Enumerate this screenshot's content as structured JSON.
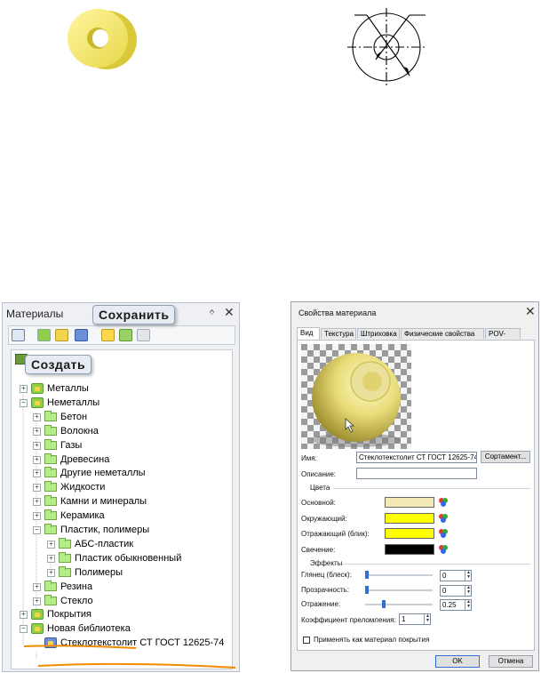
{
  "materials_panel": {
    "title": "Материалы",
    "pin_glyph": "ᛜ",
    "close_glyph": "✕",
    "callout_save": "Сохранить",
    "callout_create": "Создать",
    "tree": [
      {
        "label": "Металлы",
        "type": "library",
        "level": 0,
        "expander": "+"
      },
      {
        "label": "Неметаллы",
        "type": "library",
        "level": 0,
        "expander": "−"
      },
      {
        "label": "Бетон",
        "type": "folder",
        "level": 1,
        "expander": "+"
      },
      {
        "label": "Волокна",
        "type": "folder",
        "level": 1,
        "expander": "+"
      },
      {
        "label": "Газы",
        "type": "folder",
        "level": 1,
        "expander": "+"
      },
      {
        "label": "Древесина",
        "type": "folder",
        "level": 1,
        "expander": "+"
      },
      {
        "label": "Другие неметаллы",
        "type": "folder",
        "level": 1,
        "expander": "+"
      },
      {
        "label": "Жидкости",
        "type": "folder",
        "level": 1,
        "expander": "+"
      },
      {
        "label": "Камни и минералы",
        "type": "folder",
        "level": 1,
        "expander": "+"
      },
      {
        "label": "Керамика",
        "type": "folder",
        "level": 1,
        "expander": "+"
      },
      {
        "label": "Пластик, полимеры",
        "type": "folder",
        "level": 1,
        "expander": "−"
      },
      {
        "label": "АБС-пластик",
        "type": "folder",
        "level": 2,
        "expander": "+"
      },
      {
        "label": "Пластик обыкновенный",
        "type": "folder",
        "level": 2,
        "expander": "+"
      },
      {
        "label": "Полимеры",
        "type": "folder",
        "level": 2,
        "expander": "+"
      },
      {
        "label": "Резина",
        "type": "folder",
        "level": 1,
        "expander": "+"
      },
      {
        "label": "Стекло",
        "type": "folder",
        "level": 1,
        "expander": "+"
      },
      {
        "label": "Покрытия",
        "type": "library",
        "level": 0,
        "expander": "+"
      },
      {
        "label": "Новая библиотека",
        "type": "library",
        "level": 0,
        "expander": "−"
      },
      {
        "label": "Стеклотекстолит СТ ГОСТ 12625-74",
        "type": "material",
        "level": 1,
        "expander": ""
      }
    ],
    "highlight_color": "#f08a00"
  },
  "dialog": {
    "title": "Свойства материала",
    "close_glyph": "✕",
    "tabs": [
      "Вид",
      "Текстура",
      "Штриховка",
      "Физические свойства",
      "POV-Ray"
    ],
    "active_tab": "Вид",
    "name_label": "Имя:",
    "name_value": "Стеклотекстолит СТ ГОСТ 12625-74",
    "sortament_button": "Сортамент...",
    "description_label": "Описание:",
    "description_value": "",
    "colors_group": "Цвета",
    "colors": [
      {
        "label": "Основной:",
        "color": "#f3eab8"
      },
      {
        "label": "Окружающий:",
        "color": "#ffff00"
      },
      {
        "label": "Отражающий (блик):",
        "color": "#ffff00"
      },
      {
        "label": "Свечение:",
        "color": "#000000"
      }
    ],
    "effects_group": "Эффекты",
    "effects": [
      {
        "label": "Глянец (блеск):",
        "value": "0",
        "level": 0.0
      },
      {
        "label": "Прозрачность:",
        "value": "0",
        "level": 0.0
      },
      {
        "label": "Отражение:",
        "value": "0.25",
        "level": 0.25
      }
    ],
    "refraction_label": "Коэффициент преломления:",
    "refraction_value": "1",
    "apply_cover_label": "Применять как материал покрытия",
    "ok_button": "OK",
    "cancel_button": "Отмена"
  }
}
